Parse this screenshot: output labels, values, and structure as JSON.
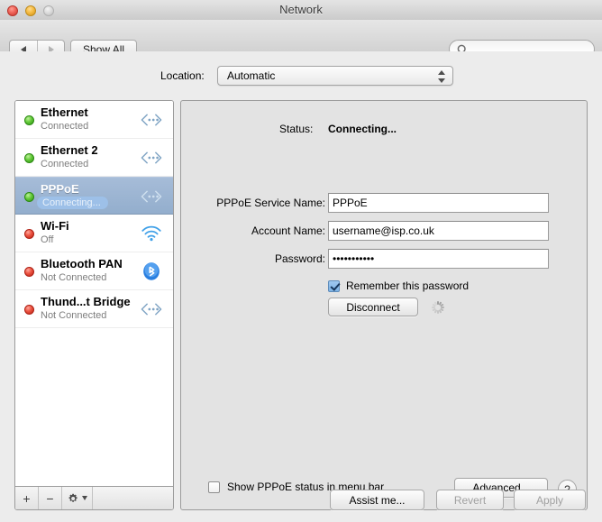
{
  "window": {
    "title": "Network",
    "traffic_lights": {
      "close": "close-button",
      "minimize": "minimize-button",
      "zoom": "zoom-button"
    }
  },
  "toolbar": {
    "back_label": "Back",
    "forward_label": "Forward",
    "show_all_label": "Show All",
    "search_placeholder": "",
    "search_value": ""
  },
  "location": {
    "label": "Location:",
    "value": "Automatic"
  },
  "sidebar": {
    "services": [
      {
        "name": "Ethernet",
        "status": "Connected",
        "dot": "green",
        "icon": "ethernet-icon"
      },
      {
        "name": "Ethernet 2",
        "status": "Connected",
        "dot": "green",
        "icon": "ethernet-icon"
      },
      {
        "name": "PPPoE",
        "status": "Connecting...",
        "dot": "green",
        "icon": "ethernet-icon",
        "selected": true
      },
      {
        "name": "Wi-Fi",
        "status": "Off",
        "dot": "red",
        "icon": "wifi-icon"
      },
      {
        "name": "Bluetooth PAN",
        "status": "Not Connected",
        "dot": "red",
        "icon": "bluetooth-icon"
      },
      {
        "name": "Thund...t Bridge",
        "status": "Not Connected",
        "dot": "red",
        "icon": "ethernet-icon"
      }
    ],
    "toolbar": {
      "add_label": "+",
      "remove_label": "−",
      "gear_label": "gear"
    }
  },
  "detail": {
    "status_label": "Status:",
    "status_value": "Connecting...",
    "fields": [
      {
        "label": "PPPoE Service Name:",
        "value": "PPPoE",
        "type": "text"
      },
      {
        "label": "Account Name:",
        "value": "username@isp.co.uk",
        "type": "text"
      },
      {
        "label": "Password:",
        "value": "•••••••••••",
        "type": "password"
      }
    ],
    "remember_password_label": "Remember this password",
    "remember_password_checked": true,
    "disconnect_label": "Disconnect",
    "show_status_label": "Show PPPoE status in menu bar",
    "show_status_checked": false,
    "advanced_label": "Advanced...",
    "help_label": "?"
  },
  "bottom": {
    "assist_label": "Assist me...",
    "revert_label": "Revert",
    "apply_label": "Apply"
  },
  "colors": {
    "selection_blue": "#93aecd",
    "status_green": "#64cb3a",
    "status_red": "#ec5341",
    "bluetooth_blue": "#2a7fe0",
    "wifi_blue": "#3fa0e8",
    "panel_bg": "#e3e3e3",
    "window_bg": "#ececec"
  }
}
